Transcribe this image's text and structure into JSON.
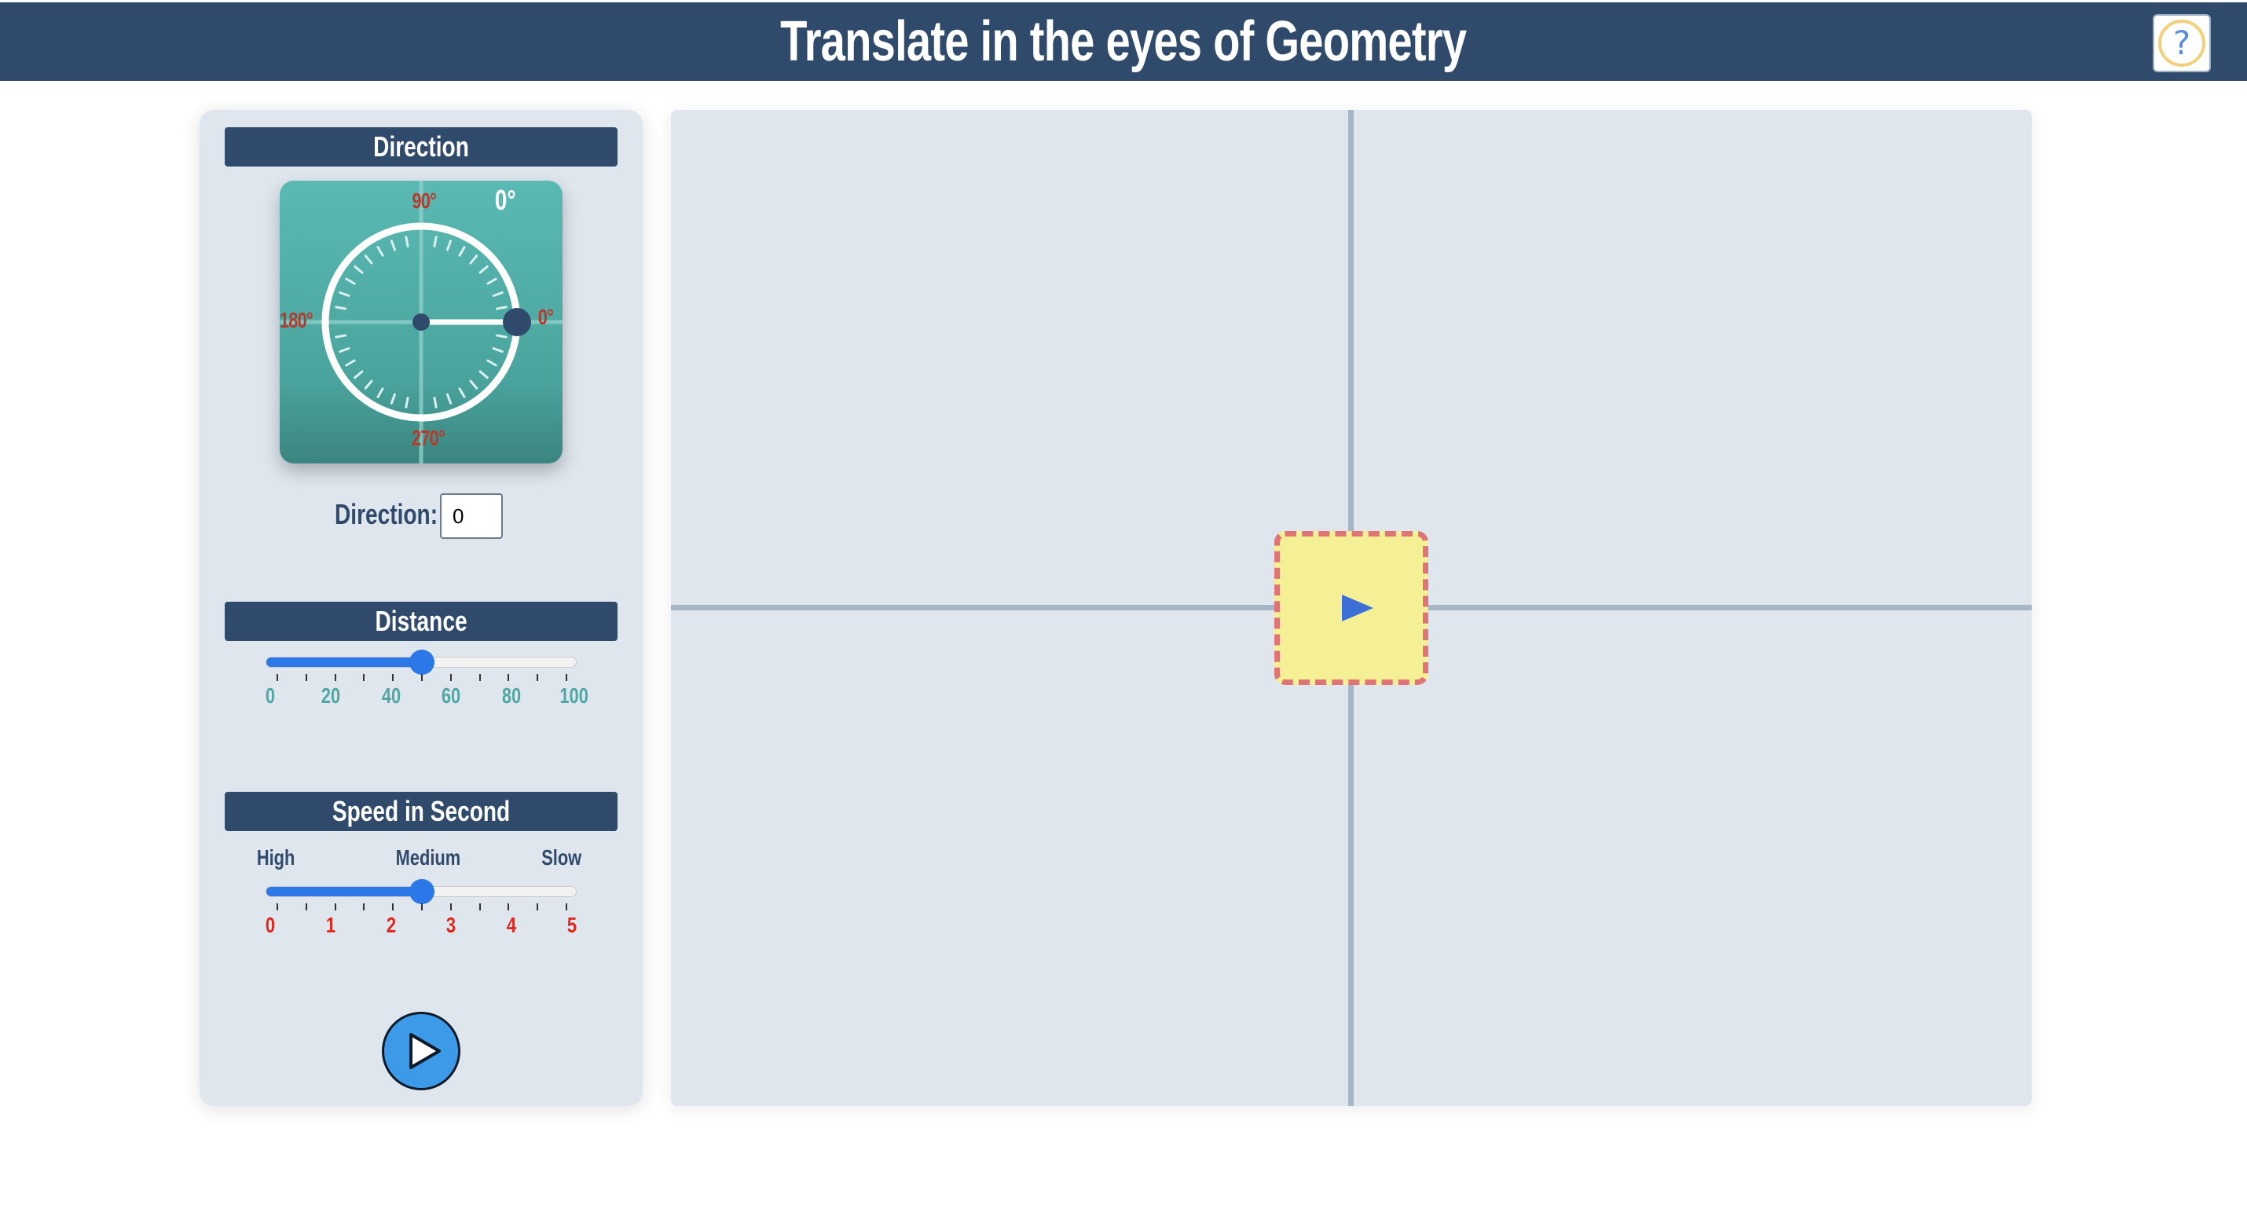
{
  "header": {
    "title": "Translate in the eyes of Geometry",
    "help_label": "?"
  },
  "direction_section": {
    "header": "Direction",
    "dial": {
      "label_90": "90°",
      "label_180": "180°",
      "label_0": "0°",
      "label_270": "270°",
      "readout": "0°",
      "angle_deg": 0
    },
    "input_label": "Direction:",
    "input_value": "0"
  },
  "distance_section": {
    "header": "Distance",
    "value": 50,
    "min": 0,
    "max": 100,
    "tick_labels": [
      "0",
      "20",
      "40",
      "60",
      "80",
      "100"
    ],
    "tick_color": "#4fa9a2"
  },
  "speed_section": {
    "header": "Speed in Second",
    "speed_words": [
      "High",
      "Medium",
      "Slow"
    ],
    "value": 2.5,
    "min": 0,
    "max": 5,
    "tick_labels": [
      "0",
      "1",
      "2",
      "3",
      "4",
      "5"
    ],
    "tick_color": "#e0281c"
  },
  "play_button": {
    "icon": "play-icon"
  },
  "canvas": {
    "shape_icon": "play-triangle-icon"
  },
  "colors": {
    "header_bg": "#2f4a6b",
    "accent": "#2d78e8",
    "shape_fill": "#f5ef96",
    "shape_border": "#e07474",
    "dial_bg": "#4aa49d"
  }
}
